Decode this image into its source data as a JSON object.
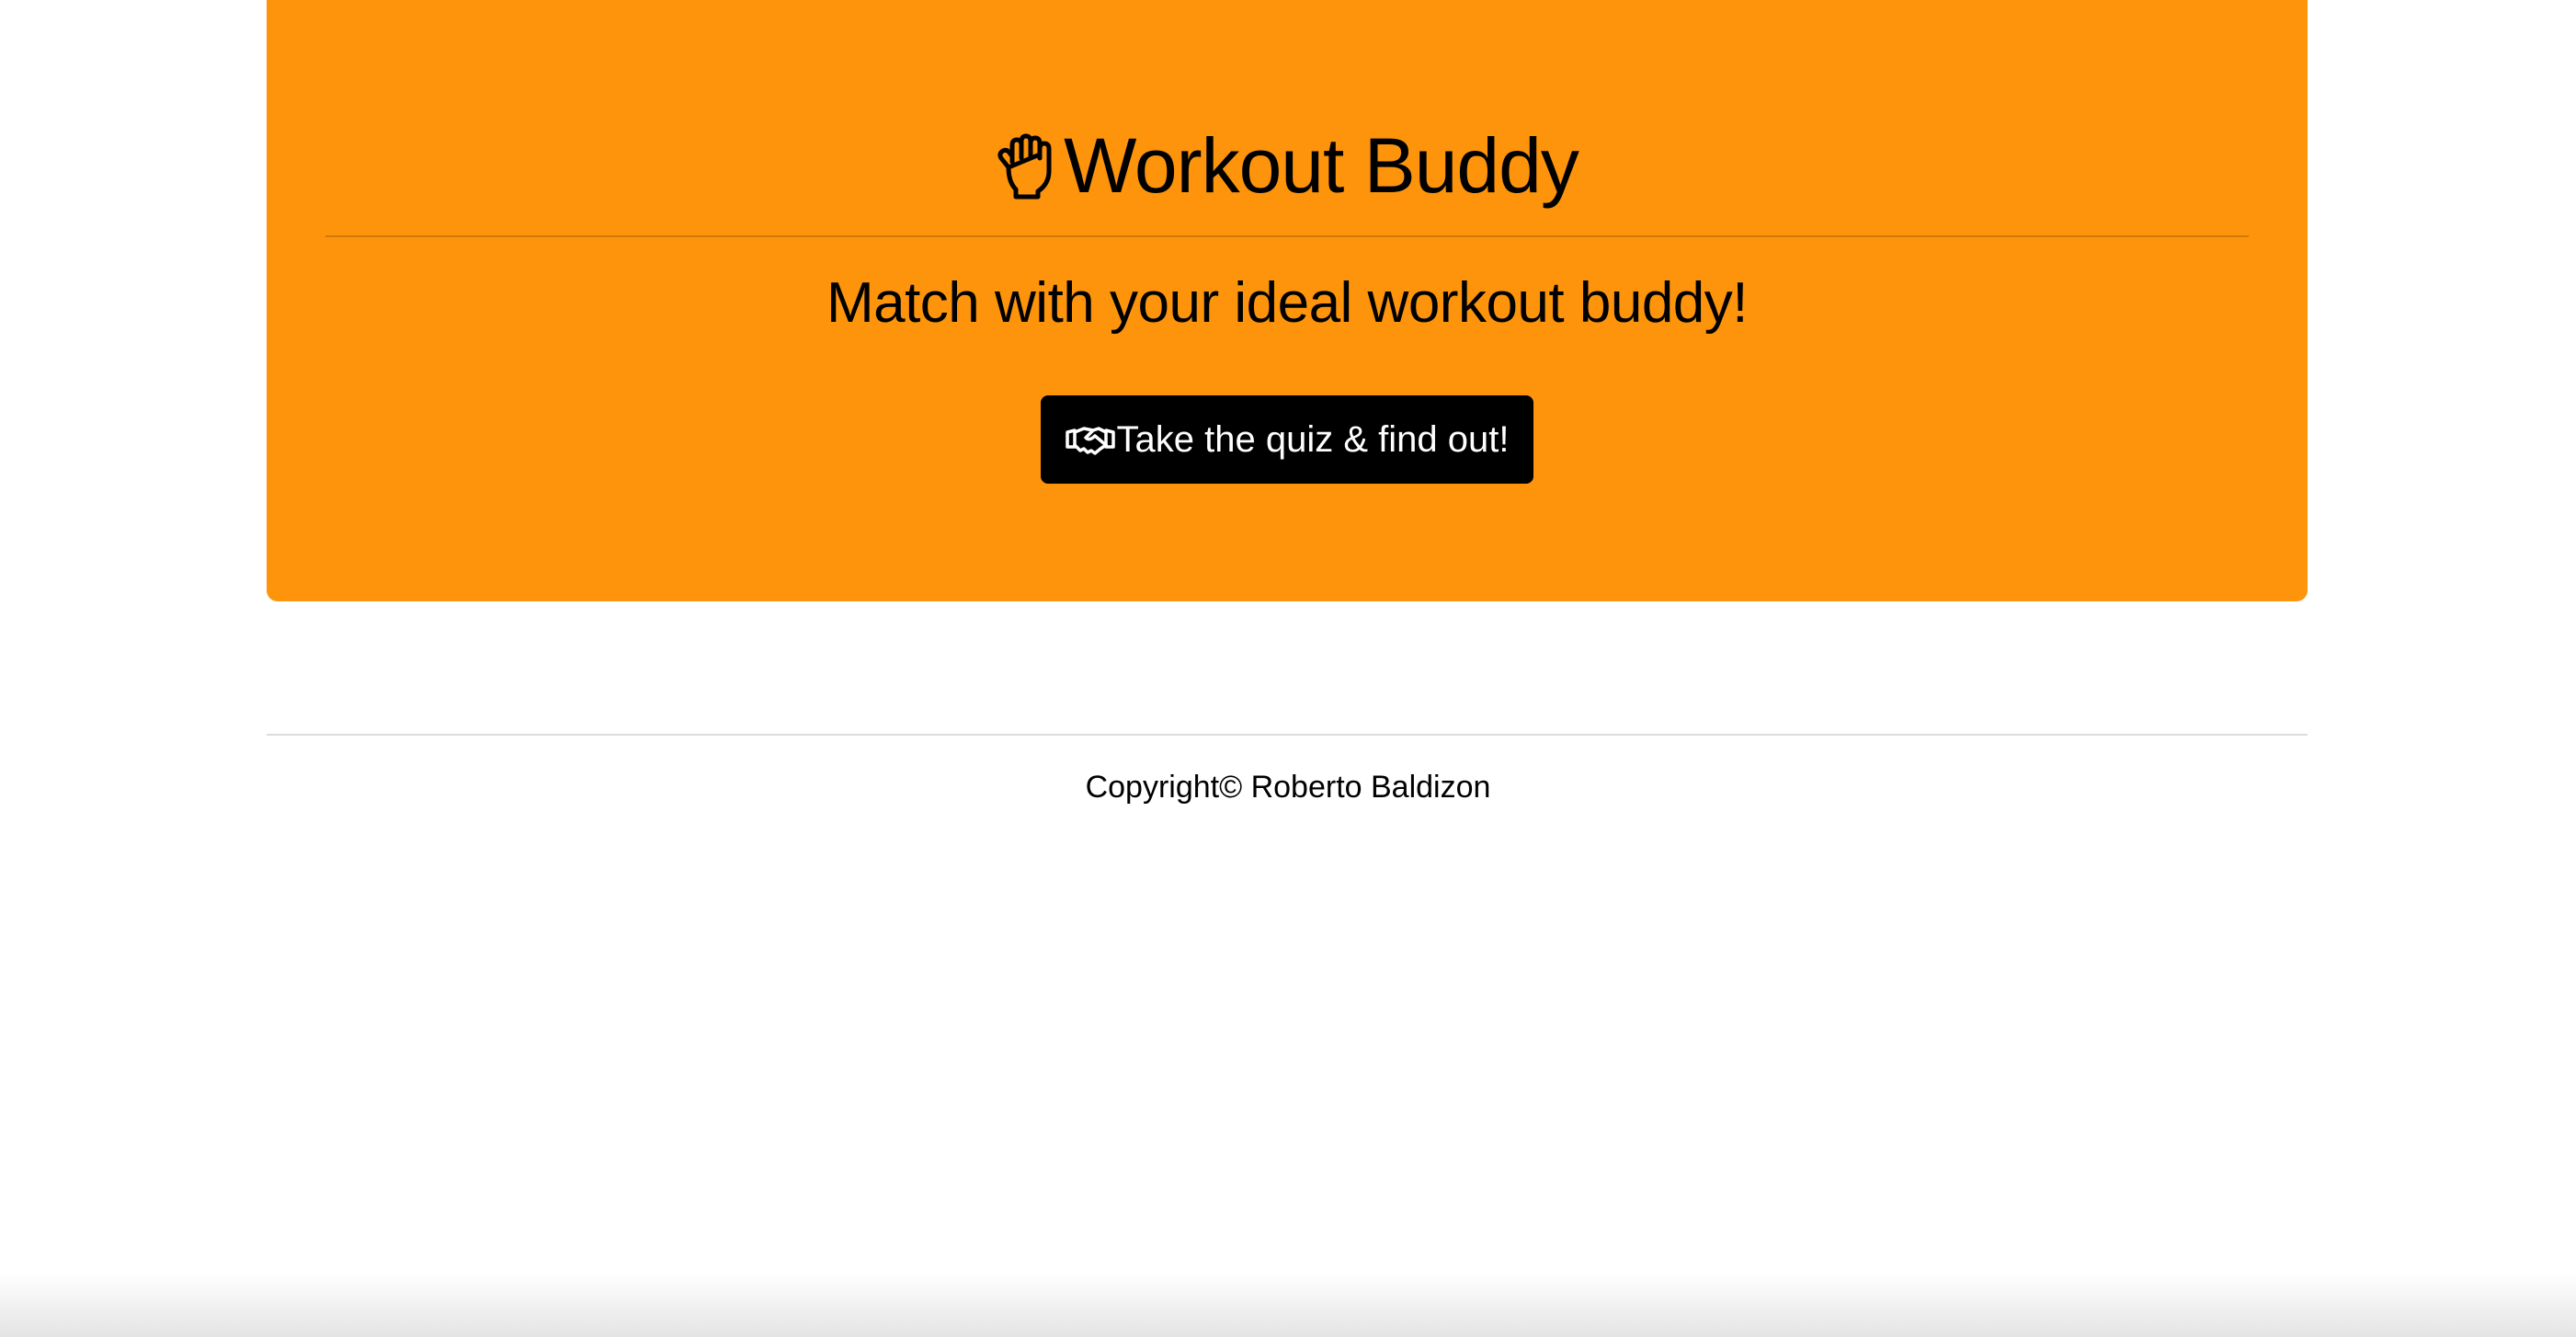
{
  "header": {
    "title_icon": "hand-fist-icon",
    "title": "Workout Buddy",
    "subtitle": "Match with your ideal workout buddy!"
  },
  "cta": {
    "icon": "handshake-icon",
    "label": "Take the quiz & find out!"
  },
  "footer": {
    "copyright": "Copyright© Roberto Baldizon"
  },
  "colors": {
    "jumbotron_bg": "#fd940b",
    "button_bg": "#000000",
    "button_text": "#ffffff"
  }
}
